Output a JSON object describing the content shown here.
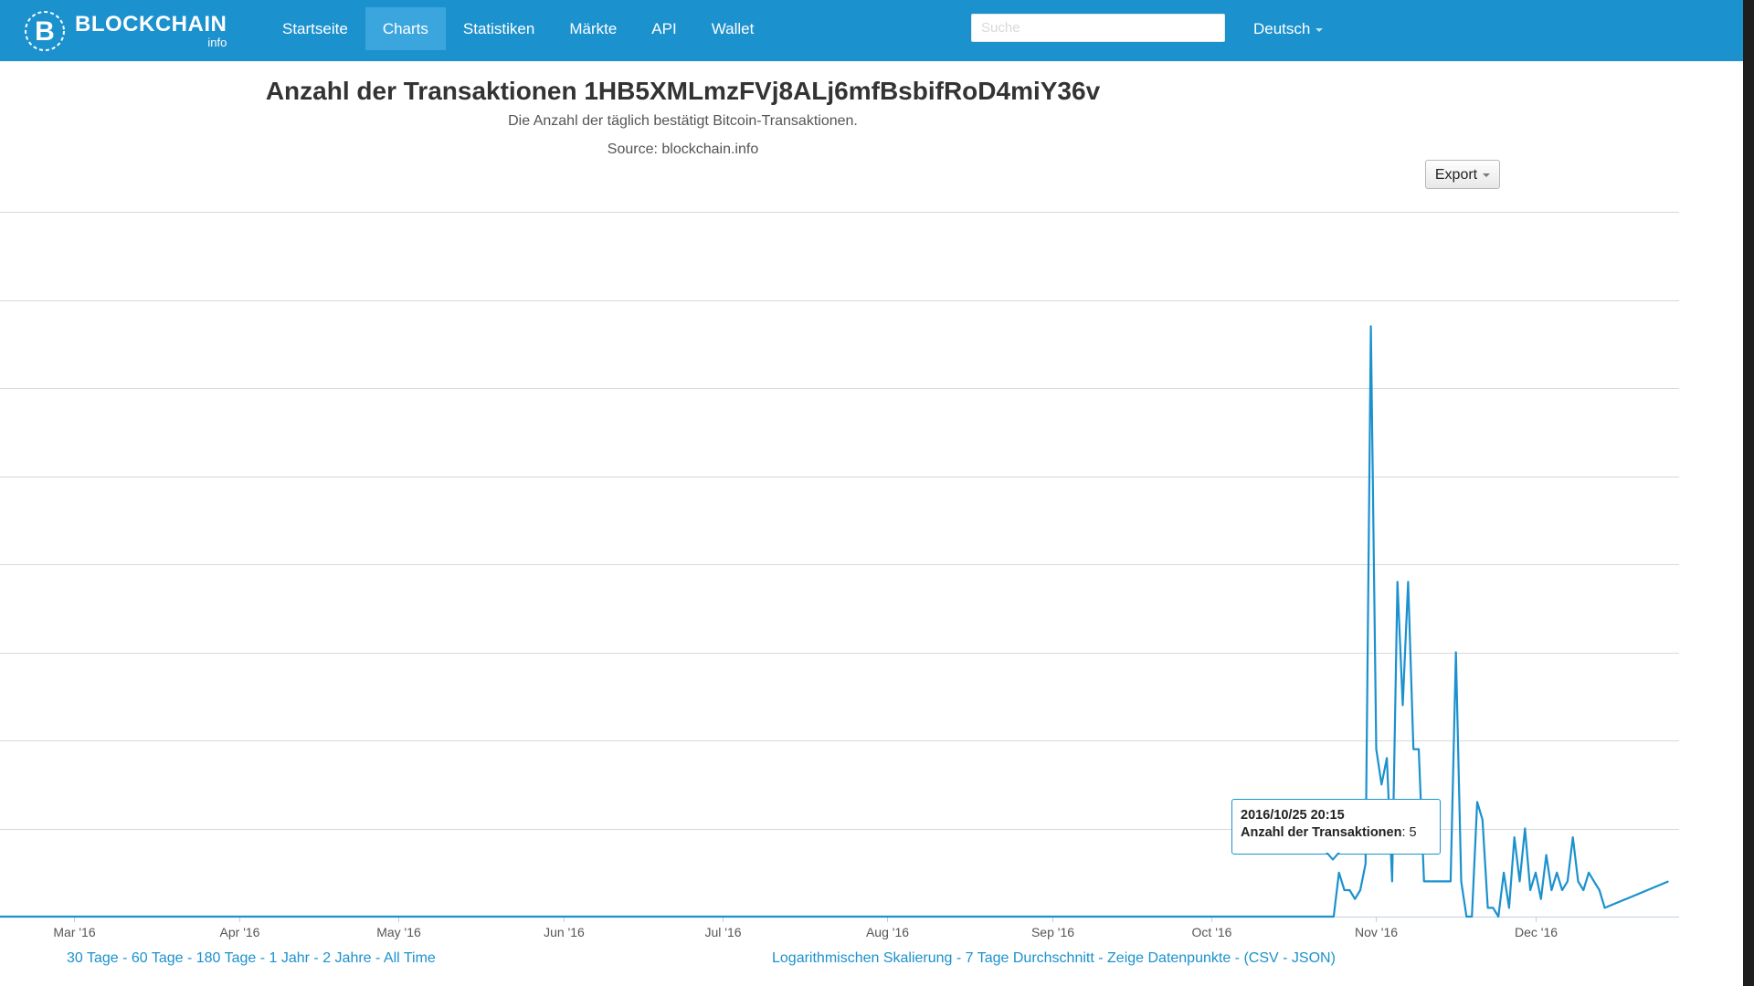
{
  "navbar": {
    "brand": {
      "name": "BLOCKCHAIN",
      "sub": "info"
    },
    "items": [
      {
        "label": "Startseite",
        "active": false
      },
      {
        "label": "Charts",
        "active": true
      },
      {
        "label": "Statistiken",
        "active": false
      },
      {
        "label": "Märkte",
        "active": false
      },
      {
        "label": "API",
        "active": false
      },
      {
        "label": "Wallet",
        "active": false
      }
    ],
    "search_placeholder": "Suche",
    "language": "Deutsch",
    "color": "#1b91ce"
  },
  "export_label": "Export",
  "tooltip": {
    "date": "2016/10/25 20:15",
    "series_label": "Anzahl der Transaktionen",
    "value_text": "5"
  },
  "footer": {
    "range_links": [
      "30 Tage",
      "60 Tage",
      "180 Tage",
      "1 Jahr",
      "2 Jahre",
      "All Time"
    ],
    "option_links": [
      "Logarithmischen Skalierung",
      "7 Tage Durchschnitt",
      "Zeige Datenpunkte"
    ],
    "export_links": [
      "CSV",
      "JSON"
    ]
  },
  "chart_data": {
    "type": "line",
    "title": "Anzahl der Transaktionen 1HB5XMLmzFVj8ALj6mfBsbifRoD4miY36v",
    "subtitle": "Die Anzahl der täglich bestätigt Bitcoin-Transaktionen.",
    "source": "Source: blockchain.info",
    "xlabel": "",
    "ylabel": "",
    "x_ticks": [
      "Mar '16",
      "Apr '16",
      "May '16",
      "Jun '16",
      "Jul '16",
      "Aug '16",
      "Sep '16",
      "Oct '16",
      "Nov '16",
      "Dec '16"
    ],
    "x_tick_dates": [
      "2016-03-01",
      "2016-04-01",
      "2016-05-01",
      "2016-06-01",
      "2016-07-01",
      "2016-08-01",
      "2016-09-01",
      "2016-10-01",
      "2016-11-01",
      "2016-12-01"
    ],
    "xlim": [
      "2016-02-16",
      "2016-12-28"
    ],
    "ylim": [
      0,
      80
    ],
    "ygrid_step": 10,
    "grid": true,
    "line_color": "#1b91ce",
    "series": [
      {
        "x": [
          "2016-02-16",
          "2016-10-24",
          "2016-10-25",
          "2016-10-26",
          "2016-10-27",
          "2016-10-28",
          "2016-10-29",
          "2016-10-30",
          "2016-10-31",
          "2016-11-01",
          "2016-11-02",
          "2016-11-03",
          "2016-11-04",
          "2016-11-05",
          "2016-11-06",
          "2016-11-07",
          "2016-11-08",
          "2016-11-09",
          "2016-11-10",
          "2016-11-11",
          "2016-11-12",
          "2016-11-13",
          "2016-11-14",
          "2016-11-15",
          "2016-11-16",
          "2016-11-17",
          "2016-11-18",
          "2016-11-19",
          "2016-11-20",
          "2016-11-21",
          "2016-11-22",
          "2016-11-23",
          "2016-11-24",
          "2016-11-25",
          "2016-11-26",
          "2016-11-27",
          "2016-11-28",
          "2016-11-29",
          "2016-11-30",
          "2016-12-01",
          "2016-12-02",
          "2016-12-03",
          "2016-12-04",
          "2016-12-05",
          "2016-12-06",
          "2016-12-07",
          "2016-12-08",
          "2016-12-09",
          "2016-12-10",
          "2016-12-11",
          "2016-12-12",
          "2016-12-13",
          "2016-12-14",
          "2016-12-26"
        ],
        "values": [
          0,
          0,
          5,
          3,
          3,
          2,
          3,
          6,
          67,
          19,
          15,
          18,
          4,
          38,
          24,
          38,
          19,
          19,
          4,
          4,
          4,
          4,
          4,
          4,
          30,
          4,
          0,
          0,
          13,
          11,
          1,
          1,
          0,
          5,
          1,
          9,
          4,
          10,
          3,
          5,
          2,
          7,
          3,
          5,
          3,
          4,
          9,
          4,
          3,
          5,
          4,
          3,
          1,
          4
        ]
      }
    ]
  }
}
